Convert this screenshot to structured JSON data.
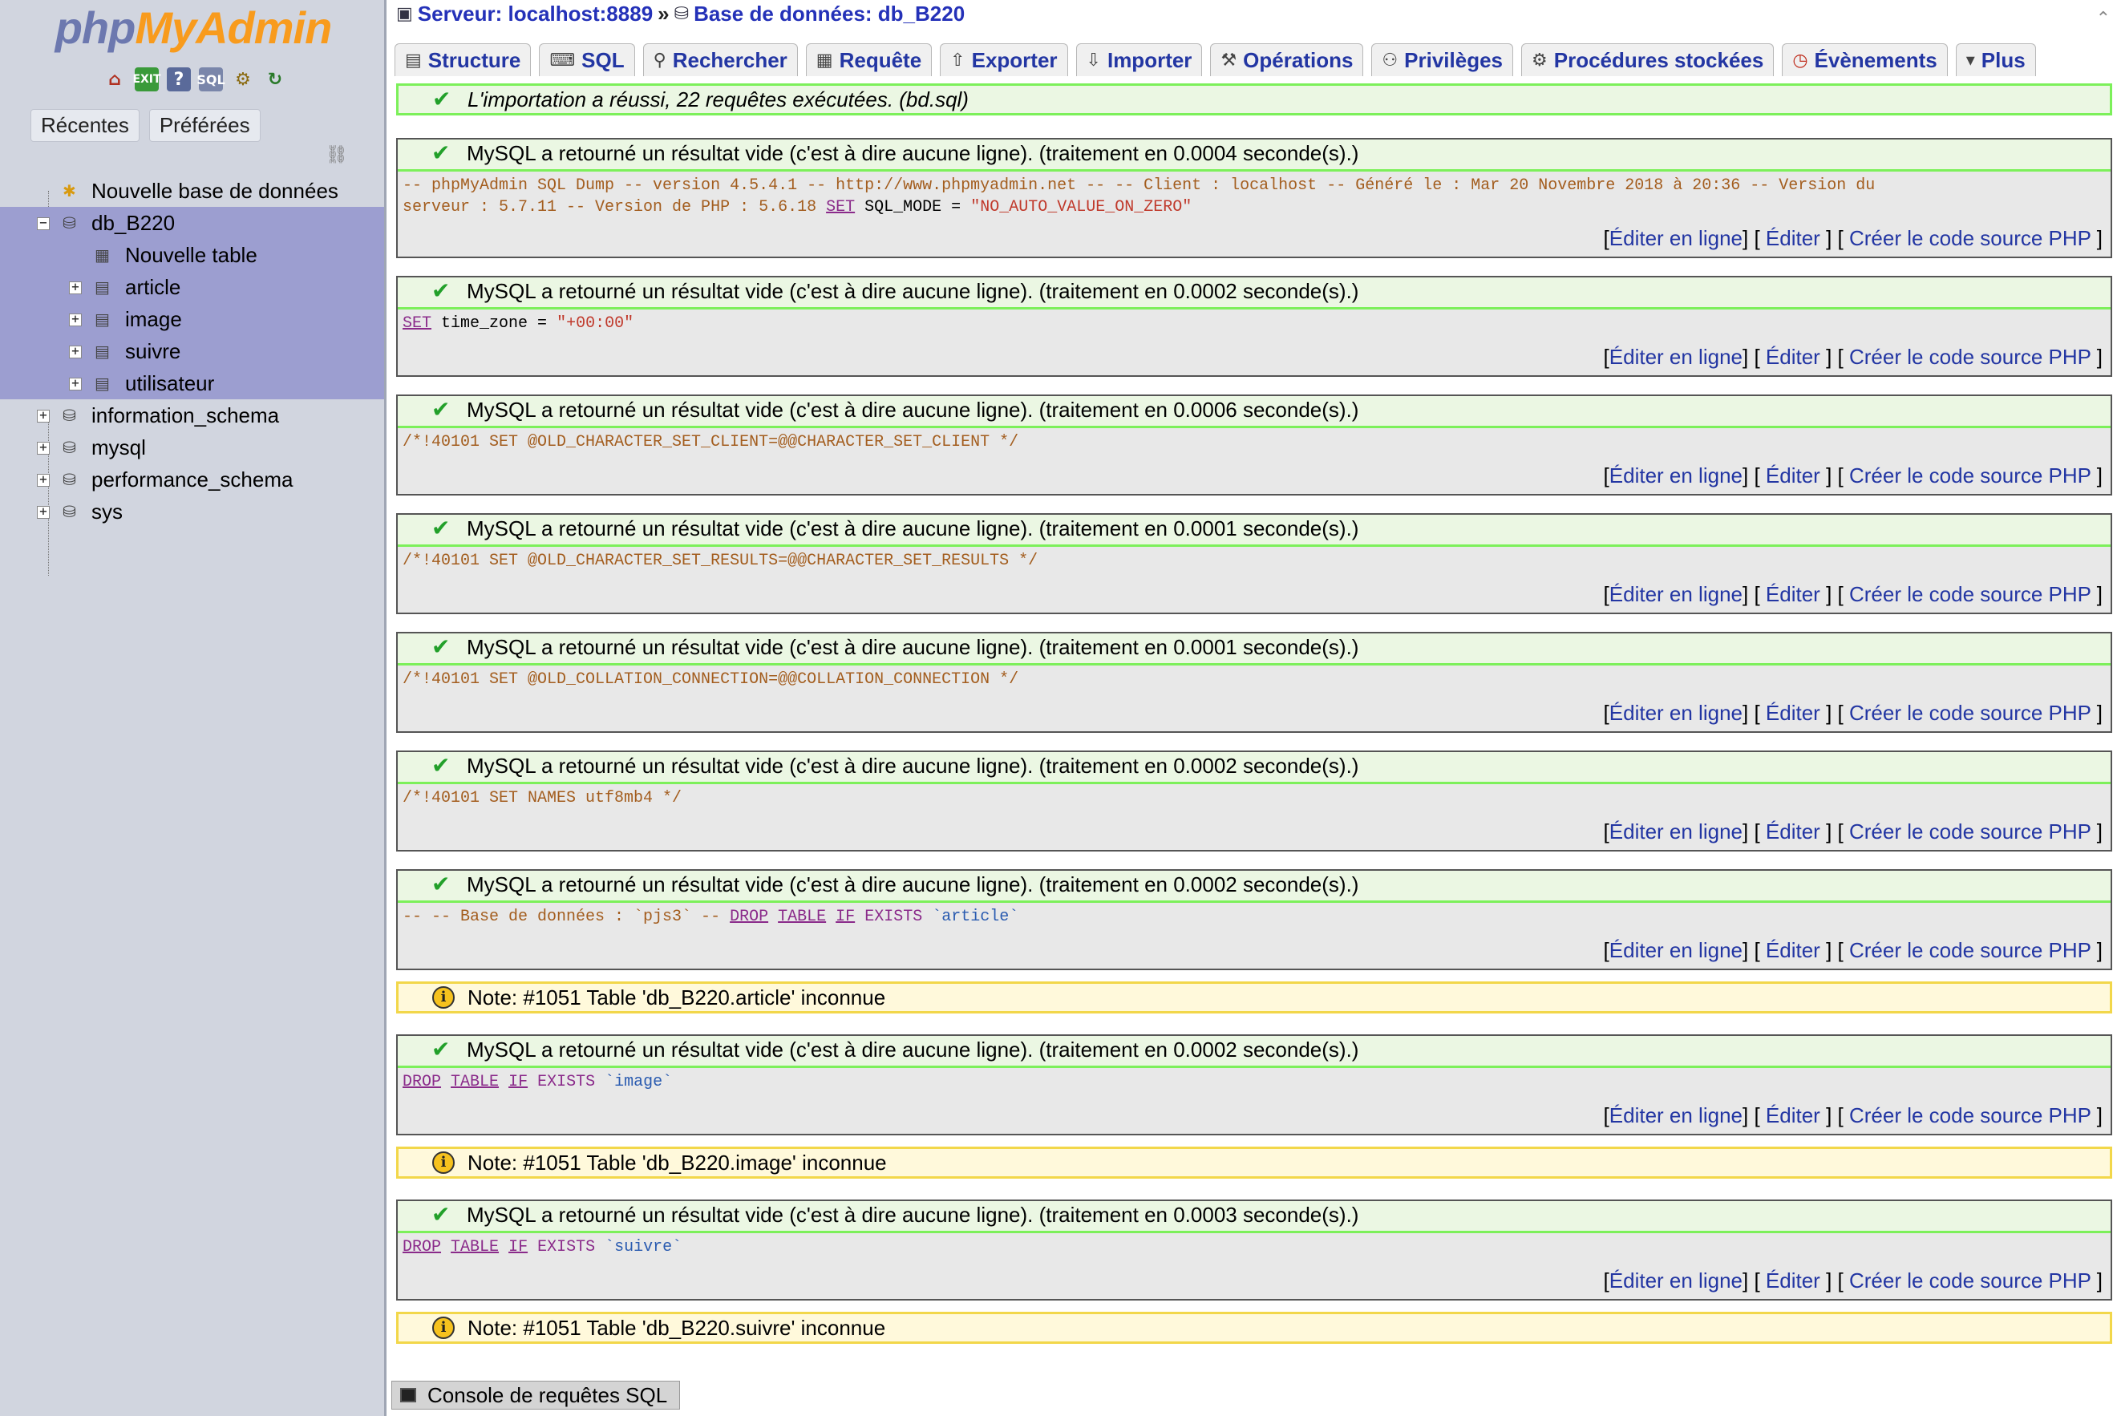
{
  "sidebar": {
    "logo_php": "php",
    "logo_myadmin": "MyAdmin",
    "quick_icons": [
      "home-icon",
      "logout-icon",
      "docs-icon",
      "sql-docs-icon",
      "settings-icon",
      "reload-icon"
    ],
    "tabs": [
      "Récentes",
      "Préférées"
    ],
    "tree": {
      "new_db": "Nouvelle base de données",
      "db_current": "db_B220",
      "new_table": "Nouvelle table",
      "tables": [
        "article",
        "image",
        "suivre",
        "utilisateur"
      ],
      "other_dbs": [
        "information_schema",
        "mysql",
        "performance_schema",
        "sys"
      ]
    }
  },
  "breadcrumb": {
    "server": "Serveur: localhost:8889",
    "sep": "»",
    "database": "Base de données: db_B220"
  },
  "tabs": [
    "Structure",
    "SQL",
    "Rechercher",
    "Requête",
    "Exporter",
    "Importer",
    "Opérations",
    "Privilèges",
    "Procédures stockées",
    "Évènements",
    "Plus"
  ],
  "import_success": "L'importation a réussi, 22 requêtes exécutées. (bd.sql)",
  "results": [
    {
      "msg": "MySQL a retourné un résultat vide (c'est à dire aucune ligne). (traitement en 0.0004 seconde(s).)",
      "sql_line1": "-- phpMyAdmin SQL Dump -- version 4.5.4.1 -- http://www.phpmyadmin.net -- -- Client : localhost -- Généré le : Mar 20 Novembre 2018 à 20:36 -- Version du",
      "sql_line2": "serveur : 5.7.11 -- Version de PHP : 5.6.18",
      "sql_kw": "SET",
      "sql_rest": "SQL_MODE =",
      "sql_str": "\"NO_AUTO_VALUE_ON_ZERO\""
    },
    {
      "msg": "MySQL a retourné un résultat vide (c'est à dire aucune ligne). (traitement en 0.0002 seconde(s).)",
      "sql_kw": "SET",
      "sql_rest": "time_zone =",
      "sql_str": "\"+00:00\""
    },
    {
      "msg": "MySQL a retourné un résultat vide (c'est à dire aucune ligne). (traitement en 0.0006 seconde(s).)",
      "sql": "/*!40101 SET @OLD_CHARACTER_SET_CLIENT=@@CHARACTER_SET_CLIENT */"
    },
    {
      "msg": "MySQL a retourné un résultat vide (c'est à dire aucune ligne). (traitement en 0.0001 seconde(s).)",
      "sql": "/*!40101 SET @OLD_CHARACTER_SET_RESULTS=@@CHARACTER_SET_RESULTS */"
    },
    {
      "msg": "MySQL a retourné un résultat vide (c'est à dire aucune ligne). (traitement en 0.0001 seconde(s).)",
      "sql": "/*!40101 SET @OLD_COLLATION_CONNECTION=@@COLLATION_CONNECTION */"
    },
    {
      "msg": "MySQL a retourné un résultat vide (c'est à dire aucune ligne). (traitement en 0.0002 seconde(s).)",
      "sql": "/*!40101 SET NAMES utf8mb4 */"
    },
    {
      "msg": "MySQL a retourné un résultat vide (c'est à dire aucune ligne). (traitement en 0.0002 seconde(s).)",
      "sql_cmt": "-- -- Base de données : `pjs3` --",
      "sql_kw1": "DROP",
      "sql_kw2": "TABLE",
      "sql_kw3": "IF",
      "sql_kw4": "EXISTS",
      "sql_ident": "`article`"
    },
    {
      "msg": "MySQL a retourné un résultat vide (c'est à dire aucune ligne). (traitement en 0.0002 seconde(s).)",
      "sql_kw1": "DROP",
      "sql_kw2": "TABLE",
      "sql_kw3": "IF",
      "sql_kw4": "EXISTS",
      "sql_ident": "`image`"
    },
    {
      "msg": "MySQL a retourné un résultat vide (c'est à dire aucune ligne). (traitement en 0.0003 seconde(s).)",
      "sql_kw1": "DROP",
      "sql_kw2": "TABLE",
      "sql_kw3": "IF",
      "sql_kw4": "EXISTS",
      "sql_ident": "`suivre`"
    }
  ],
  "notes": [
    "Note: #1051 Table 'db_B220.article' inconnue",
    "Note: #1051 Table 'db_B220.image' inconnue",
    "Note: #1051 Table 'db_B220.suivre' inconnue"
  ],
  "actions": {
    "open": "[",
    "edit_inline": "Éditer en ligne",
    "mid1": "] [",
    "edit": "Éditer",
    "mid2": "] [",
    "php_code": "Créer le code source PHP",
    "close": "]"
  },
  "console": "Console de requêtes SQL",
  "colors": {
    "success_border": "#7cf05a",
    "note_border": "#f2d74a",
    "link": "#2336a3",
    "sidebar_bg": "#d1d5df",
    "tree_selected": "#9c9ed0"
  }
}
